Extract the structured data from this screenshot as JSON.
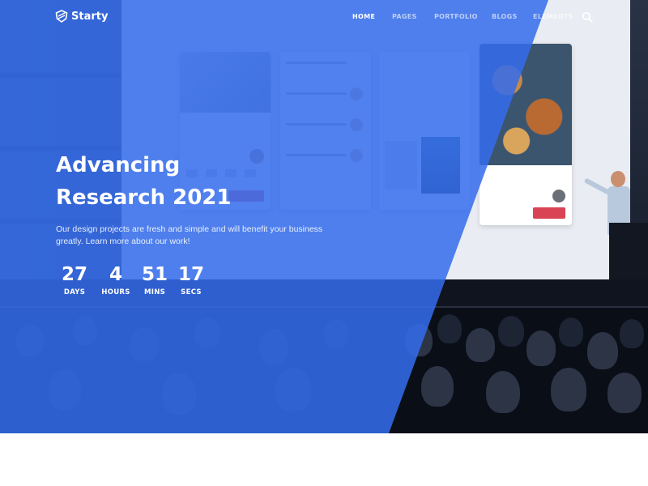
{
  "brand": {
    "name": "Starty",
    "logo_icon": "shield-logo-icon"
  },
  "nav": {
    "items": [
      "HOME",
      "PAGES",
      "PORTFOLIO",
      "BLOGS",
      "ELEMENTS"
    ],
    "active": "HOME",
    "search_icon": "search-icon"
  },
  "hero": {
    "title_line1": "Advancing",
    "title_line2": "Research 2021",
    "description": "Our design projects are fresh and simple and will benefit your business greatly. Learn more about our work!",
    "overlay_color": "#346cec"
  },
  "countdown": [
    {
      "value": "27",
      "label": "DAYS"
    },
    {
      "value": "4",
      "label": "HOURS"
    },
    {
      "value": "51",
      "label": "MINS"
    },
    {
      "value": "17",
      "label": "SECS"
    }
  ]
}
